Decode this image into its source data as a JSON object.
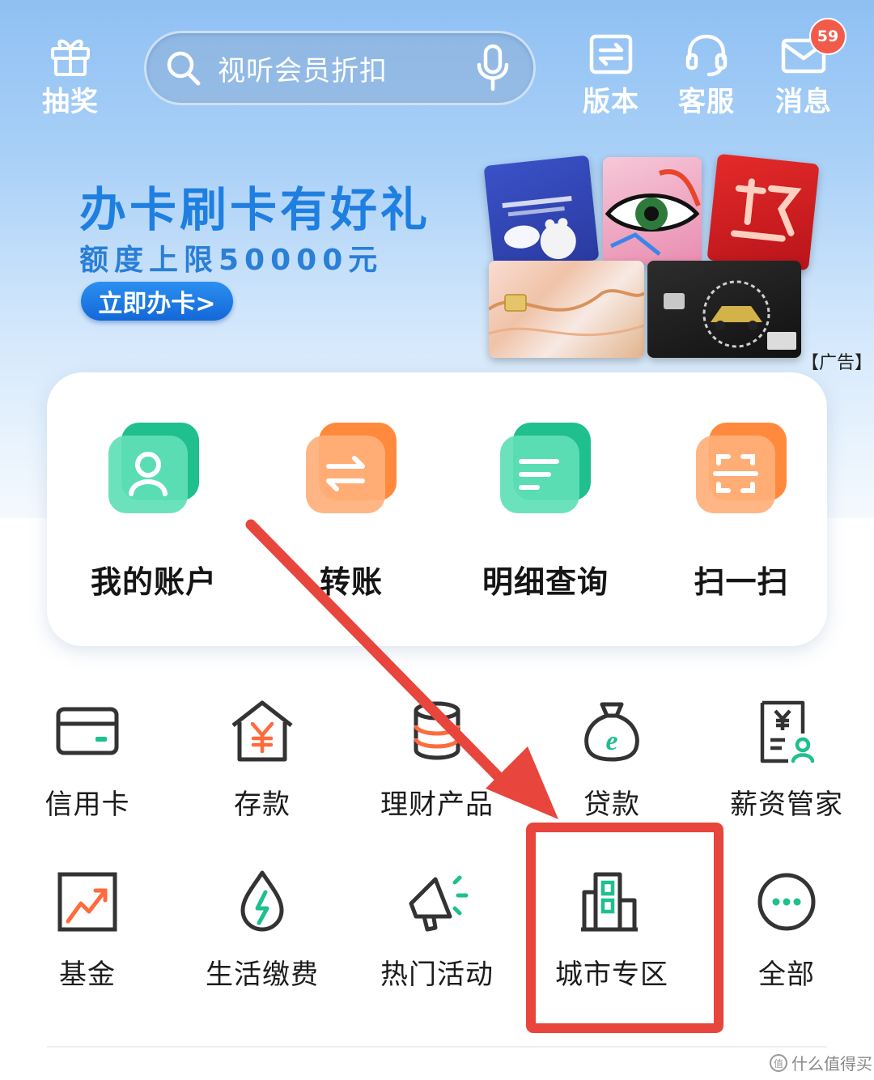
{
  "header": {
    "lottery_label": "抽奖",
    "search_placeholder": "视听会员折扣",
    "version_label": "版本",
    "service_label": "客服",
    "message_label": "消息",
    "message_badge": "59"
  },
  "banner": {
    "title": "办卡刷卡有好礼",
    "subtitle": "额度上限50000元",
    "button_label": "立即办卡>",
    "ad_tag": "【广告】"
  },
  "quick_actions": [
    {
      "label": "我的账户",
      "icon": "user-icon"
    },
    {
      "label": "转账",
      "icon": "transfer-icon"
    },
    {
      "label": "明细查询",
      "icon": "list-icon"
    },
    {
      "label": "扫一扫",
      "icon": "scan-icon"
    }
  ],
  "services": [
    {
      "label": "信用卡",
      "icon": "credit-card-icon"
    },
    {
      "label": "存款",
      "icon": "deposit-icon"
    },
    {
      "label": "理财产品",
      "icon": "wealth-icon"
    },
    {
      "label": "贷款",
      "icon": "loan-icon"
    },
    {
      "label": "薪资管家",
      "icon": "salary-icon"
    },
    {
      "label": "基金",
      "icon": "fund-icon"
    },
    {
      "label": "生活缴费",
      "icon": "utility-icon"
    },
    {
      "label": "热门活动",
      "icon": "megaphone-icon"
    },
    {
      "label": "城市专区",
      "icon": "city-icon"
    },
    {
      "label": "全部",
      "icon": "more-icon"
    }
  ],
  "watermark": "什么值得买",
  "colors": {
    "brand_blue": "#1f7fe0",
    "green_accent": "#1fb58a",
    "orange_accent": "#ff7a3c",
    "annotation_red": "#e8453c"
  }
}
